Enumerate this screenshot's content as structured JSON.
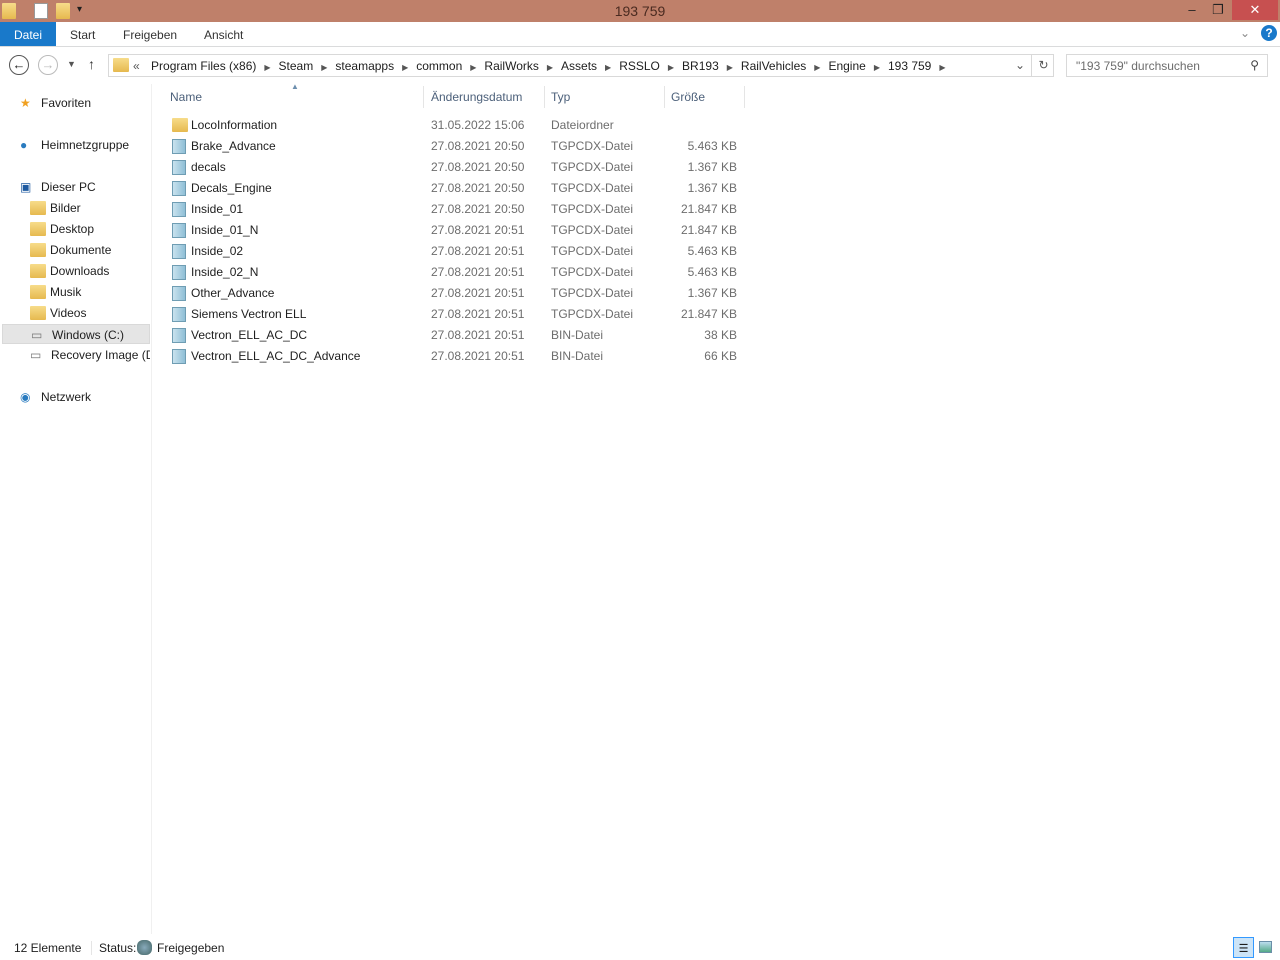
{
  "window": {
    "title": "193 759",
    "minimize": "–",
    "restore": "❐",
    "close": "✕"
  },
  "ribbon": {
    "tabs": [
      "Datei",
      "Start",
      "Freigeben",
      "Ansicht"
    ],
    "help": "?",
    "collapse": "⌄"
  },
  "address": {
    "prefix": "«",
    "crumbs": [
      "Program Files (x86)",
      "Steam",
      "steamapps",
      "common",
      "RailWorks",
      "Assets",
      "RSSLO",
      "BR193",
      "RailVehicles",
      "Engine",
      "193 759"
    ]
  },
  "search": {
    "placeholder": "\"193 759\" durchsuchen"
  },
  "sidebar": {
    "items": [
      {
        "label": "Favoriten",
        "icon": "star-icon"
      },
      {
        "label": "Heimnetzgruppe",
        "icon": "homegroup-icon"
      },
      {
        "label": "Dieser PC",
        "icon": "computer-icon"
      },
      {
        "label": "Bilder",
        "icon": "pictures-folder-icon"
      },
      {
        "label": "Desktop",
        "icon": "desktop-folder-icon"
      },
      {
        "label": "Dokumente",
        "icon": "documents-folder-icon"
      },
      {
        "label": "Downloads",
        "icon": "downloads-folder-icon"
      },
      {
        "label": "Musik",
        "icon": "music-folder-icon"
      },
      {
        "label": "Videos",
        "icon": "videos-folder-icon"
      },
      {
        "label": "Windows (C:)",
        "icon": "drive-icon",
        "selected": true
      },
      {
        "label": "Recovery Image (D",
        "icon": "drive-icon"
      },
      {
        "label": "Netzwerk",
        "icon": "network-icon"
      }
    ]
  },
  "columns": [
    "Name",
    "Änderungsdatum",
    "Typ",
    "Größe"
  ],
  "files": [
    {
      "name": "LocoInformation",
      "date": "31.05.2022 15:06",
      "type": "Dateiordner",
      "size": "",
      "icon": "folder-icon"
    },
    {
      "name": "Brake_Advance",
      "date": "27.08.2021 20:50",
      "type": "TGPCDX-Datei",
      "size": "5.463 KB",
      "icon": "file-icon"
    },
    {
      "name": "decals",
      "date": "27.08.2021 20:50",
      "type": "TGPCDX-Datei",
      "size": "1.367 KB",
      "icon": "file-icon"
    },
    {
      "name": "Decals_Engine",
      "date": "27.08.2021 20:50",
      "type": "TGPCDX-Datei",
      "size": "1.367 KB",
      "icon": "file-icon"
    },
    {
      "name": "Inside_01",
      "date": "27.08.2021 20:50",
      "type": "TGPCDX-Datei",
      "size": "21.847 KB",
      "icon": "file-icon"
    },
    {
      "name": "Inside_01_N",
      "date": "27.08.2021 20:51",
      "type": "TGPCDX-Datei",
      "size": "21.847 KB",
      "icon": "file-icon"
    },
    {
      "name": "Inside_02",
      "date": "27.08.2021 20:51",
      "type": "TGPCDX-Datei",
      "size": "5.463 KB",
      "icon": "file-icon"
    },
    {
      "name": "Inside_02_N",
      "date": "27.08.2021 20:51",
      "type": "TGPCDX-Datei",
      "size": "5.463 KB",
      "icon": "file-icon"
    },
    {
      "name": "Other_Advance",
      "date": "27.08.2021 20:51",
      "type": "TGPCDX-Datei",
      "size": "1.367 KB",
      "icon": "file-icon"
    },
    {
      "name": "Siemens Vectron ELL",
      "date": "27.08.2021 20:51",
      "type": "TGPCDX-Datei",
      "size": "21.847 KB",
      "icon": "file-icon"
    },
    {
      "name": "Vectron_ELL_AC_DC",
      "date": "27.08.2021 20:51",
      "type": "BIN-Datei",
      "size": "38 KB",
      "icon": "file-icon"
    },
    {
      "name": "Vectron_ELL_AC_DC_Advance",
      "date": "27.08.2021 20:51",
      "type": "BIN-Datei",
      "size": "66 KB",
      "icon": "file-icon"
    }
  ],
  "status": {
    "count": "12 Elemente",
    "label": "Status:",
    "state": "Freigegeben"
  },
  "colors": {
    "titlebar": "#bf806a",
    "accent": "#1979ca",
    "close": "#c75050"
  }
}
